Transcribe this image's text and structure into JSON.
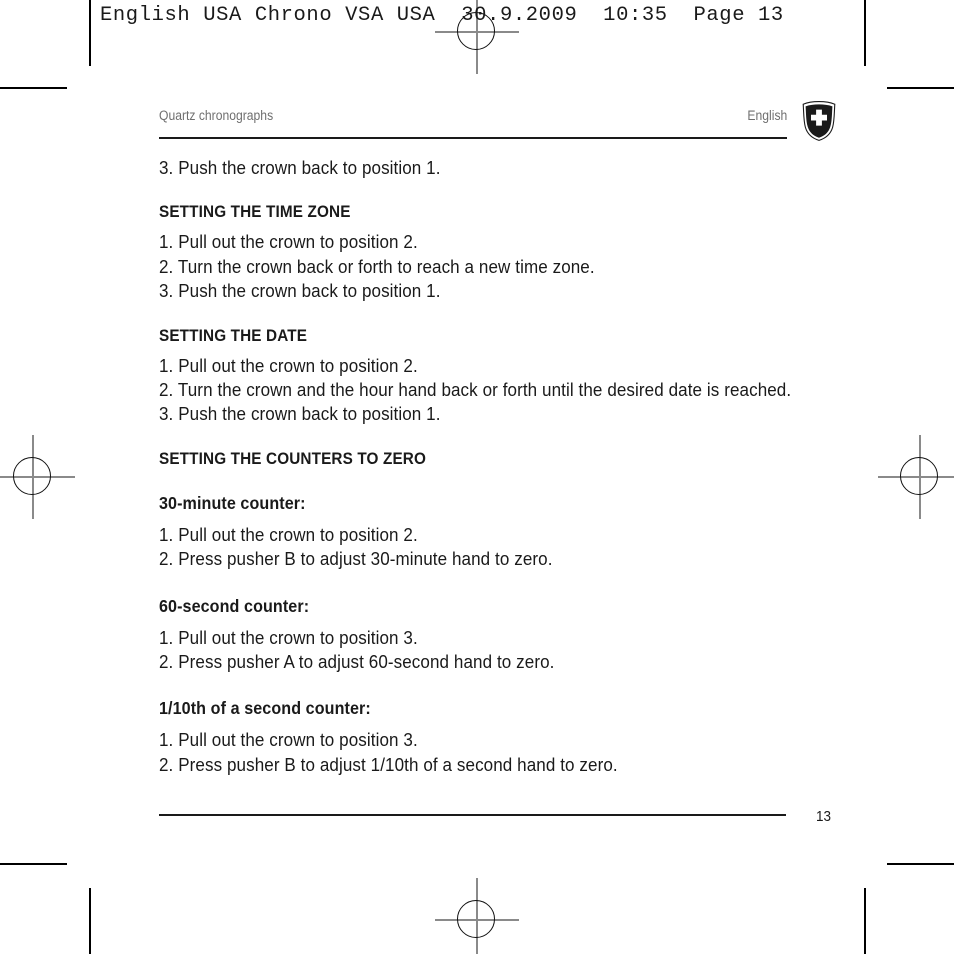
{
  "proof_header": {
    "text": "English USA Chrono VSA USA  30.9.2009  10:35  Page 13"
  },
  "running_head": {
    "left": "Quartz chronographs",
    "right": "English",
    "logo_name": "victorinox-shield-logo"
  },
  "body": {
    "lead_step": "3.  Push the crown back to position 1.",
    "sections": [
      {
        "heading": "SETTING THE TIME ZONE",
        "steps": [
          "1.  Pull out the crown to position 2.",
          "2.  Turn the crown back or forth to reach a new time zone.",
          "3.  Push the crown back to position 1."
        ]
      },
      {
        "heading": "SETTING THE DATE",
        "steps": [
          "1.  Pull out the crown to position 2.",
          "2.  Turn the crown and the hour hand back or forth until the desired date is reached.",
          "3.  Push the crown back to position 1."
        ]
      }
    ],
    "counters_heading": "SETTING THE COUNTERS TO ZERO",
    "counters": [
      {
        "subheading": "30-minute counter:",
        "steps": [
          "1.  Pull out the crown to position 2.",
          "2.  Press pusher B to adjust 30-minute hand to zero."
        ]
      },
      {
        "subheading": "60-second counter:",
        "steps": [
          "1.  Pull out the crown to position 3.",
          "2.  Press pusher A to adjust 60-second hand to zero."
        ]
      },
      {
        "subheading": "1/10th of a second counter:",
        "steps": [
          "1.  Pull out the crown to position 3.",
          "2.  Press pusher B to adjust 1/10th of a second hand to zero."
        ]
      }
    ]
  },
  "footer": {
    "page_number": "13"
  },
  "colors": {
    "text": "#1a1a1a",
    "muted": "#6f6f6f",
    "rule": "#1a1a1a",
    "reg_mark": "#8a8a8a"
  }
}
